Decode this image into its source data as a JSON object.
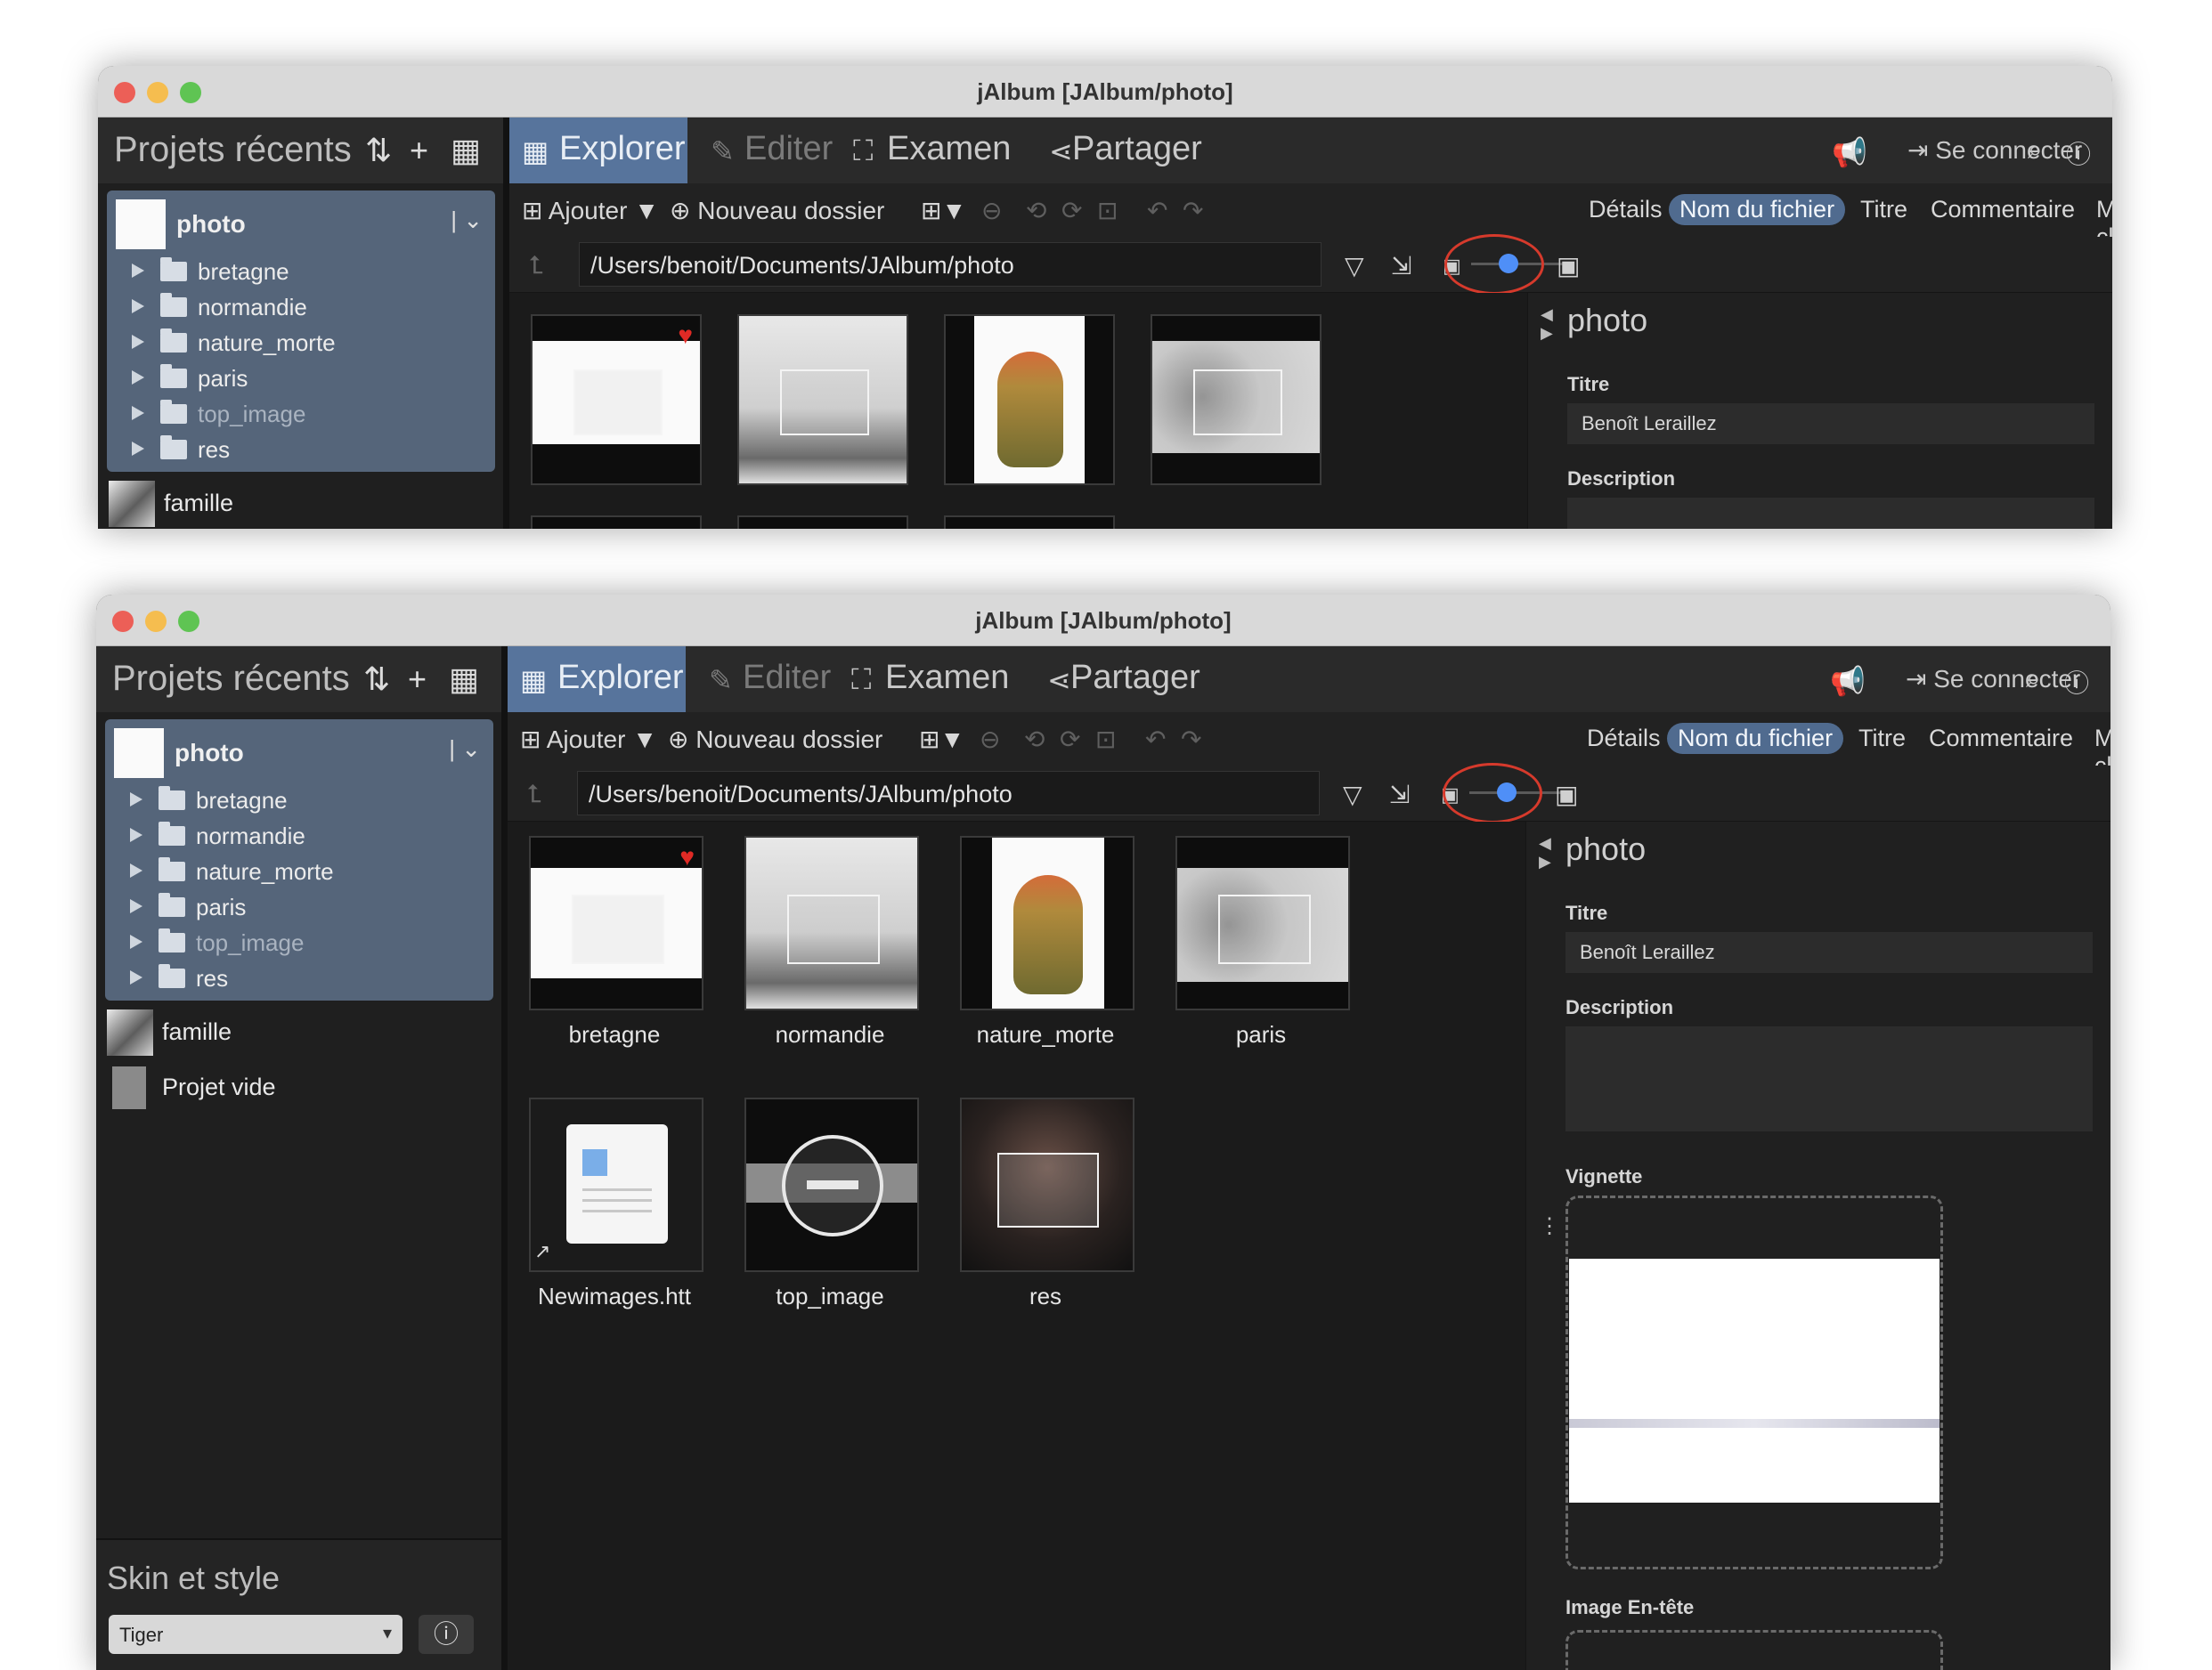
{
  "window": {
    "title": "jAlbum [JAlbum/photo]",
    "traffic_lights": [
      "#ec5f57",
      "#f5bd4f",
      "#5fc453"
    ]
  },
  "sidebar": {
    "header_title": "Projets récents",
    "header_icons": [
      "sort-icon",
      "add-icon",
      "grid-view-icon"
    ],
    "current_project": "photo",
    "tree": [
      {
        "label": "bretagne",
        "dim": false
      },
      {
        "label": "normandie",
        "dim": false
      },
      {
        "label": "nature_morte",
        "dim": false
      },
      {
        "label": "paris",
        "dim": false
      },
      {
        "label": "top_image",
        "dim": true
      },
      {
        "label": "res",
        "dim": false
      }
    ],
    "other_projects": [
      {
        "label": "famille"
      },
      {
        "label": "Projet vide"
      }
    ],
    "skin_title": "Skin et style",
    "skin_value": "Tiger"
  },
  "tabs": [
    {
      "label": "Explorer",
      "active": true
    },
    {
      "label": "Editer",
      "disabled": true
    },
    {
      "label": "Examen"
    },
    {
      "label": "Partager"
    }
  ],
  "header_right": {
    "connect_label": "Se connecter"
  },
  "toolbar": {
    "add_label": "Ajouter",
    "new_folder_label": "Nouveau dossier",
    "sort_options": [
      "Détails",
      "Nom du fichier",
      "Titre",
      "Commentaire",
      "Mots-clés"
    ],
    "sort_selected": "Nom du fichier"
  },
  "path": "/Users/benoit/Documents/JAlbum/photo",
  "items": [
    {
      "label": "bretagne",
      "favorite": true
    },
    {
      "label": "normandie"
    },
    {
      "label": "nature_morte"
    },
    {
      "label": "paris"
    },
    {
      "label": "Newimages.htt"
    },
    {
      "label": "top_image"
    },
    {
      "label": "res"
    }
  ],
  "properties": {
    "folder_name": "photo",
    "title_label": "Titre",
    "title_value": "Benoît Leraillez",
    "description_label": "Description",
    "description_value": "",
    "thumbnail_label": "Vignette",
    "header_image_label": "Image En-tête"
  },
  "colors": {
    "accent_active_tab": "#57749c",
    "toggle_knob": "#4f8ff7",
    "annotation_circle": "#d63a2c",
    "favorite_heart": "#e02a25"
  }
}
